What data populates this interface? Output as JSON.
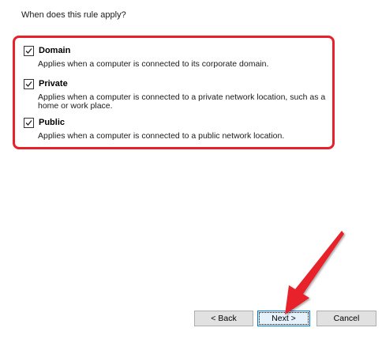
{
  "question": "When does this rule apply?",
  "options": [
    {
      "title": "Domain",
      "checked": true,
      "description": "Applies when a computer is connected to its corporate domain."
    },
    {
      "title": "Private",
      "checked": true,
      "description": "Applies when a computer is connected to a private network location, such as a home or work place."
    },
    {
      "title": "Public",
      "checked": true,
      "description": "Applies when a computer is connected to a public network location."
    }
  ],
  "buttons": {
    "back": "< Back",
    "next": "Next >",
    "cancel": "Cancel"
  },
  "colors": {
    "annotation_red": "#e8202a",
    "primary_button_border": "#0078d7"
  },
  "icons": {
    "checkbox_checked": "checkmark-icon",
    "annotation_arrow": "red-arrow-icon"
  }
}
